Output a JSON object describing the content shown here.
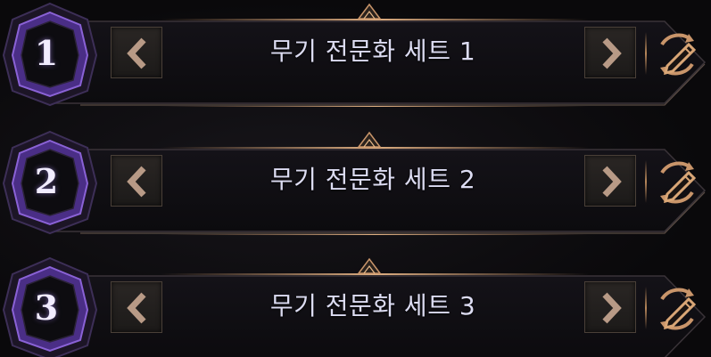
{
  "sets": [
    {
      "number": "1",
      "title": "무기 전문화 세트 1"
    },
    {
      "number": "2",
      "title": "무기 전문화 세트 2"
    },
    {
      "number": "3",
      "title": "무기 전문화 세트 3"
    }
  ],
  "icons": {
    "prev": "chevron-left-icon",
    "next": "chevron-right-icon",
    "edit": "pencil-swap-icon"
  },
  "colors": {
    "gold": "#c9956a",
    "badge_purple": "#6a3fb0",
    "title_text": "#dcdcf2"
  }
}
